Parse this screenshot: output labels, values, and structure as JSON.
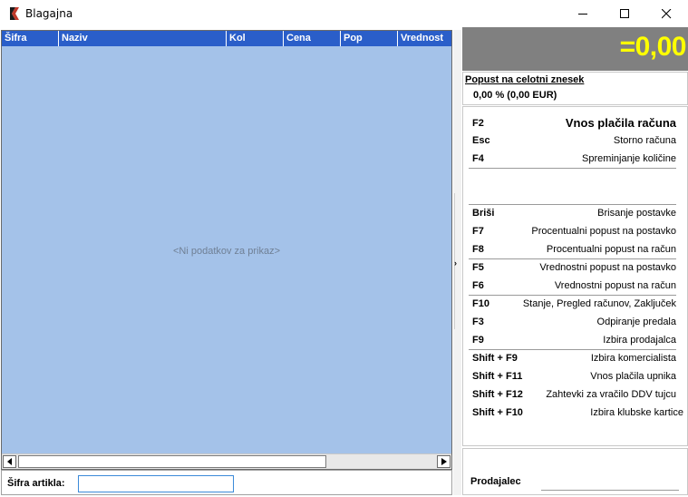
{
  "window": {
    "title": "Blagajna",
    "controls": {
      "minimize": "minimize-icon",
      "maximize": "maximize-icon",
      "close": "close-icon"
    }
  },
  "grid": {
    "columns": [
      "Šifra",
      "Naziv",
      "Kol",
      "Cena",
      "Pop",
      "Vrednost"
    ],
    "rows": [],
    "empty_message": "<Ni podatkov za prikaz>",
    "header_color": "#2a5ec9",
    "body_color": "#a4c2e9"
  },
  "article_input": {
    "label": "Šifra artikla:",
    "value": ""
  },
  "total": {
    "value": "=0,00",
    "color": "#ffff00",
    "background": "#808080"
  },
  "discount": {
    "title": "Popust na celotni znesek",
    "value": "0,00 %   (0,00 EUR)"
  },
  "shortcuts": [
    {
      "key": "F2",
      "desc": "Vnos plačila računa"
    },
    {
      "key": "Esc",
      "desc": "Storno računa"
    },
    {
      "key": "F4",
      "desc": "Spreminjanje količine"
    },
    {
      "key": "Briši",
      "desc": "Brisanje postavke"
    },
    {
      "key": "F7",
      "desc": "Procentualni popust na postavko"
    },
    {
      "key": "F8",
      "desc": "Procentualni popust na račun"
    },
    {
      "key": "F5",
      "desc": "Vrednostni popust na postavko"
    },
    {
      "key": "F6",
      "desc": "Vrednostni popust na račun"
    },
    {
      "key": "F10",
      "desc": "Stanje, Pregled računov, Zaključek"
    },
    {
      "key": "F3",
      "desc": "Odpiranje predala"
    },
    {
      "key": "F9",
      "desc": "Izbira prodajalca"
    },
    {
      "key": "Shift + F9",
      "desc": "Izbira komercialista"
    },
    {
      "key": "Shift + F11",
      "desc": "Vnos plačila upnika"
    },
    {
      "key": "Shift + F12",
      "desc": "Zahtevki za vračilo DDV tujcu"
    },
    {
      "key": "Shift + F10",
      "desc": "Izbira klubske kartice"
    }
  ],
  "seller": {
    "label": "Prodajalec",
    "value": ""
  }
}
